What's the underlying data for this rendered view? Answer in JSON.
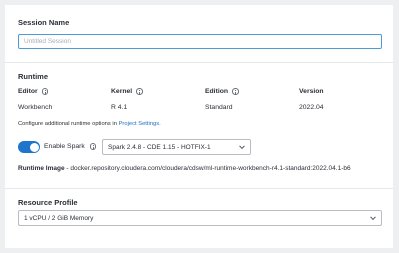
{
  "session": {
    "name_label": "Session Name",
    "name_placeholder": "Untitled Session",
    "name_value": ""
  },
  "runtime": {
    "title": "Runtime",
    "columns": [
      {
        "label": "Editor",
        "value": "Workbench"
      },
      {
        "label": "Kernel",
        "value": "R 4.1"
      },
      {
        "label": "Edition",
        "value": "Standard"
      },
      {
        "label": "Version",
        "value": "2022.04"
      }
    ],
    "config_text_prefix": "Configure additional runtime options in",
    "config_link": "Project Settings.",
    "spark_toggle_label": "Enable Spark",
    "spark_enabled": true,
    "spark_version": "Spark 2.4.8 - CDE 1.15 - HOTFIX-1",
    "image_label": "Runtime Image",
    "image_value": " - docker.repository.cloudera.com/cloudera/cdsw/ml-runtime-workbench-r4.1-standard:2022.04.1-b6"
  },
  "resource": {
    "title": "Resource Profile",
    "profile_value": "1 vCPU / 2 GiB Memory"
  },
  "colors": {
    "accent": "#1f75cc",
    "input_focus_border": "#4c9ad6",
    "link": "#1f6fc5"
  }
}
